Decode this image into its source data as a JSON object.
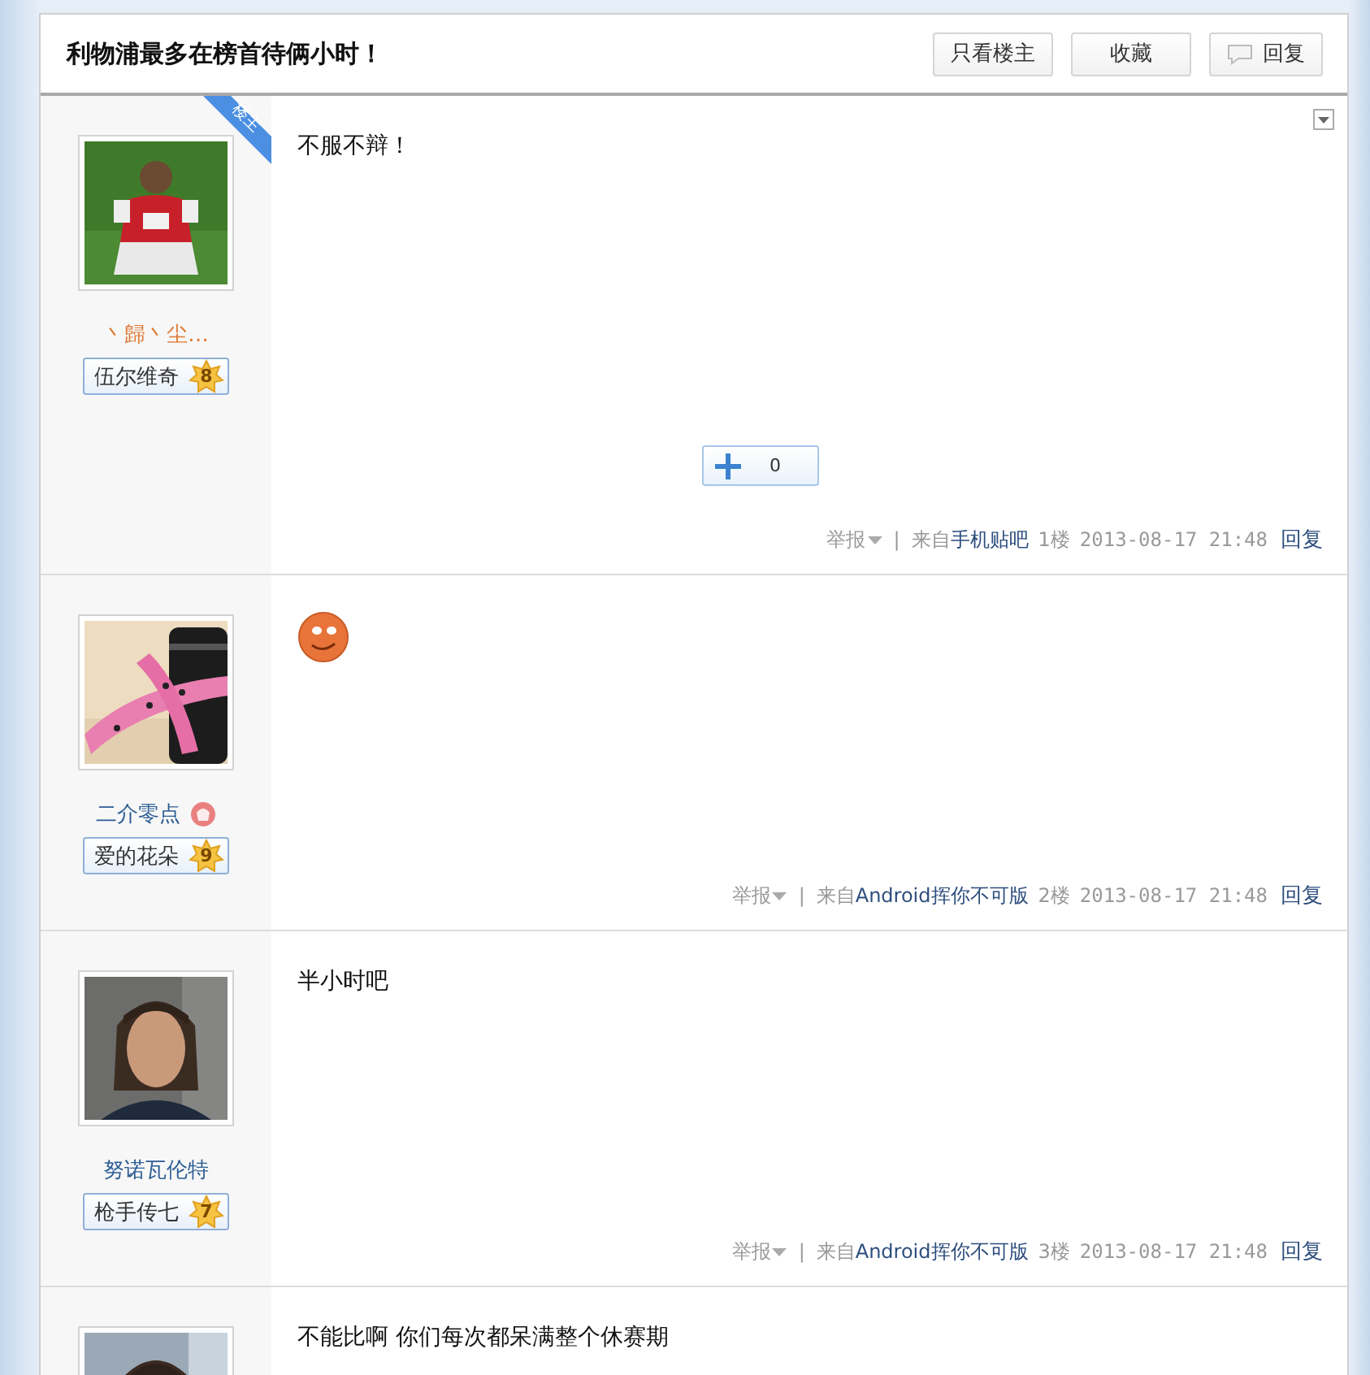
{
  "thread": {
    "title": "利物浦最多在榜首待俩小时！",
    "buttons": [
      {
        "label": "只看楼主",
        "kind": "plain"
      },
      {
        "label": "收藏",
        "kind": "plain"
      },
      {
        "label": "回复",
        "kind": "reply"
      }
    ]
  },
  "posts": [
    {
      "author": {
        "name": "丶歸丶尘…",
        "color": "#e07a35",
        "level_title": "伍尔维奇",
        "level": "8",
        "owner_badge": "楼主"
      },
      "text": "不服不辩！",
      "menu": true,
      "vote": {
        "count": "0"
      },
      "footer": {
        "report": "举报",
        "separator": "|",
        "from": "来自",
        "source": "手机贴吧",
        "floor": "1楼",
        "time": "2013-08-17 21:48",
        "reply": "回复"
      }
    },
    {
      "author": {
        "name": "二介零点",
        "color": "#2d5d95",
        "level_title": "爱的花朵",
        "level": "9",
        "medal": true
      },
      "emoji": true,
      "footer": {
        "report": "举报",
        "separator": "|",
        "from": "来自",
        "source": "Android挥你不可版",
        "floor": "2楼",
        "time": "2013-08-17 21:48",
        "reply": "回复"
      }
    },
    {
      "author": {
        "name": "努诺瓦伦特",
        "color": "#2d5d95",
        "level_title": "枪手传七",
        "level": "7"
      },
      "text": "半小时吧",
      "footer": {
        "report": "举报",
        "separator": "|",
        "from": "来自",
        "source": "Android挥你不可版",
        "floor": "3楼",
        "time": "2013-08-17 21:48",
        "reply": "回复"
      }
    },
    {
      "text": "不能比啊  你们每次都呆满整个休赛期"
    }
  ]
}
